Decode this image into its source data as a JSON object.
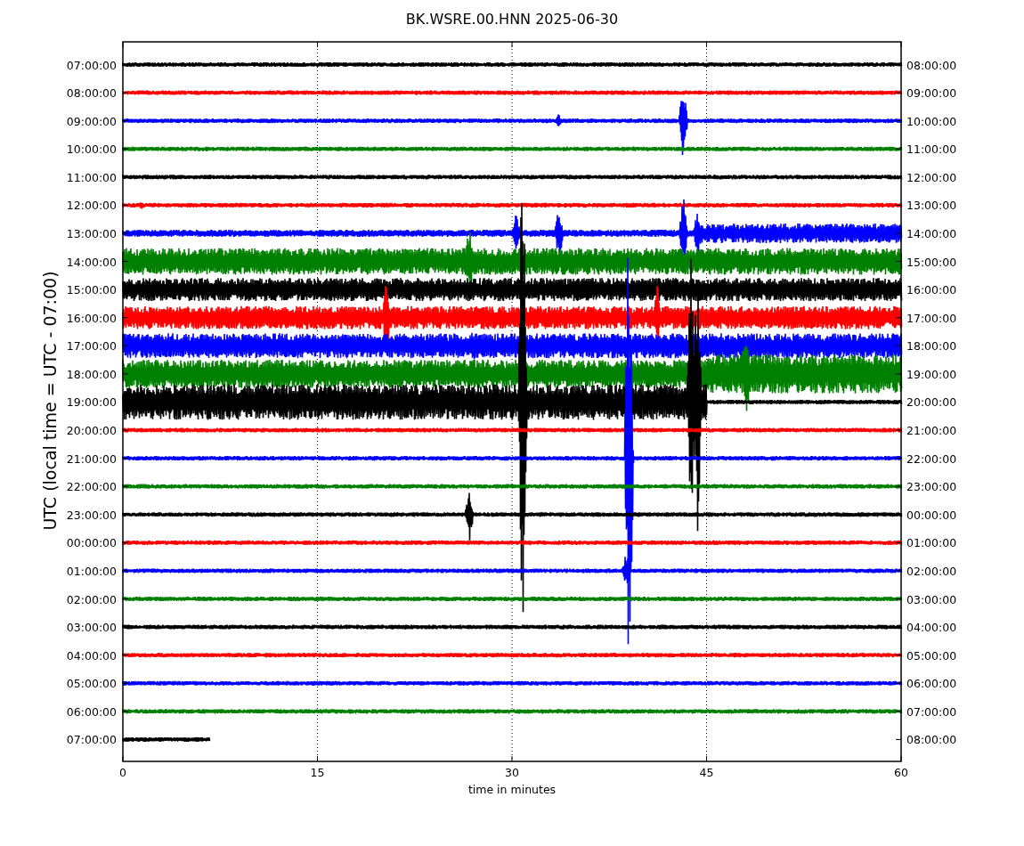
{
  "title": "BK.WSRE.00.HNN 2025-06-30",
  "ylabel": "UTC (local time = UTC - 07:00)",
  "xlabel": "time in minutes",
  "xticks": [
    "0",
    "15",
    "30",
    "45",
    "60"
  ],
  "rows": [
    {
      "left": "07:00:00",
      "right": "08:00:00",
      "color": "#000000"
    },
    {
      "left": "08:00:00",
      "right": "09:00:00",
      "color": "#ff0000"
    },
    {
      "left": "09:00:00",
      "right": "10:00:00",
      "color": "#0000ff"
    },
    {
      "left": "10:00:00",
      "right": "11:00:00",
      "color": "#008000"
    },
    {
      "left": "11:00:00",
      "right": "12:00:00",
      "color": "#000000"
    },
    {
      "left": "12:00:00",
      "right": "13:00:00",
      "color": "#ff0000"
    },
    {
      "left": "13:00:00",
      "right": "14:00:00",
      "color": "#0000ff"
    },
    {
      "left": "14:00:00",
      "right": "15:00:00",
      "color": "#008000"
    },
    {
      "left": "15:00:00",
      "right": "16:00:00",
      "color": "#000000"
    },
    {
      "left": "16:00:00",
      "right": "17:00:00",
      "color": "#ff0000"
    },
    {
      "left": "17:00:00",
      "right": "18:00:00",
      "color": "#0000ff"
    },
    {
      "left": "18:00:00",
      "right": "19:00:00",
      "color": "#008000"
    },
    {
      "left": "19:00:00",
      "right": "20:00:00",
      "color": "#000000"
    },
    {
      "left": "20:00:00",
      "right": "21:00:00",
      "color": "#ff0000"
    },
    {
      "left": "21:00:00",
      "right": "22:00:00",
      "color": "#0000ff"
    },
    {
      "left": "22:00:00",
      "right": "23:00:00",
      "color": "#008000"
    },
    {
      "left": "23:00:00",
      "right": "00:00:00",
      "color": "#000000"
    },
    {
      "left": "00:00:00",
      "right": "01:00:00",
      "color": "#ff0000"
    },
    {
      "left": "01:00:00",
      "right": "02:00:00",
      "color": "#0000ff"
    },
    {
      "left": "02:00:00",
      "right": "03:00:00",
      "color": "#008000"
    },
    {
      "left": "03:00:00",
      "right": "04:00:00",
      "color": "#000000"
    },
    {
      "left": "04:00:00",
      "right": "05:00:00",
      "color": "#ff0000"
    },
    {
      "left": "05:00:00",
      "right": "06:00:00",
      "color": "#0000ff"
    },
    {
      "left": "06:00:00",
      "right": "07:00:00",
      "color": "#008000"
    },
    {
      "left": "07:00:00",
      "right": "08:00:00",
      "color": "#000000"
    }
  ]
}
